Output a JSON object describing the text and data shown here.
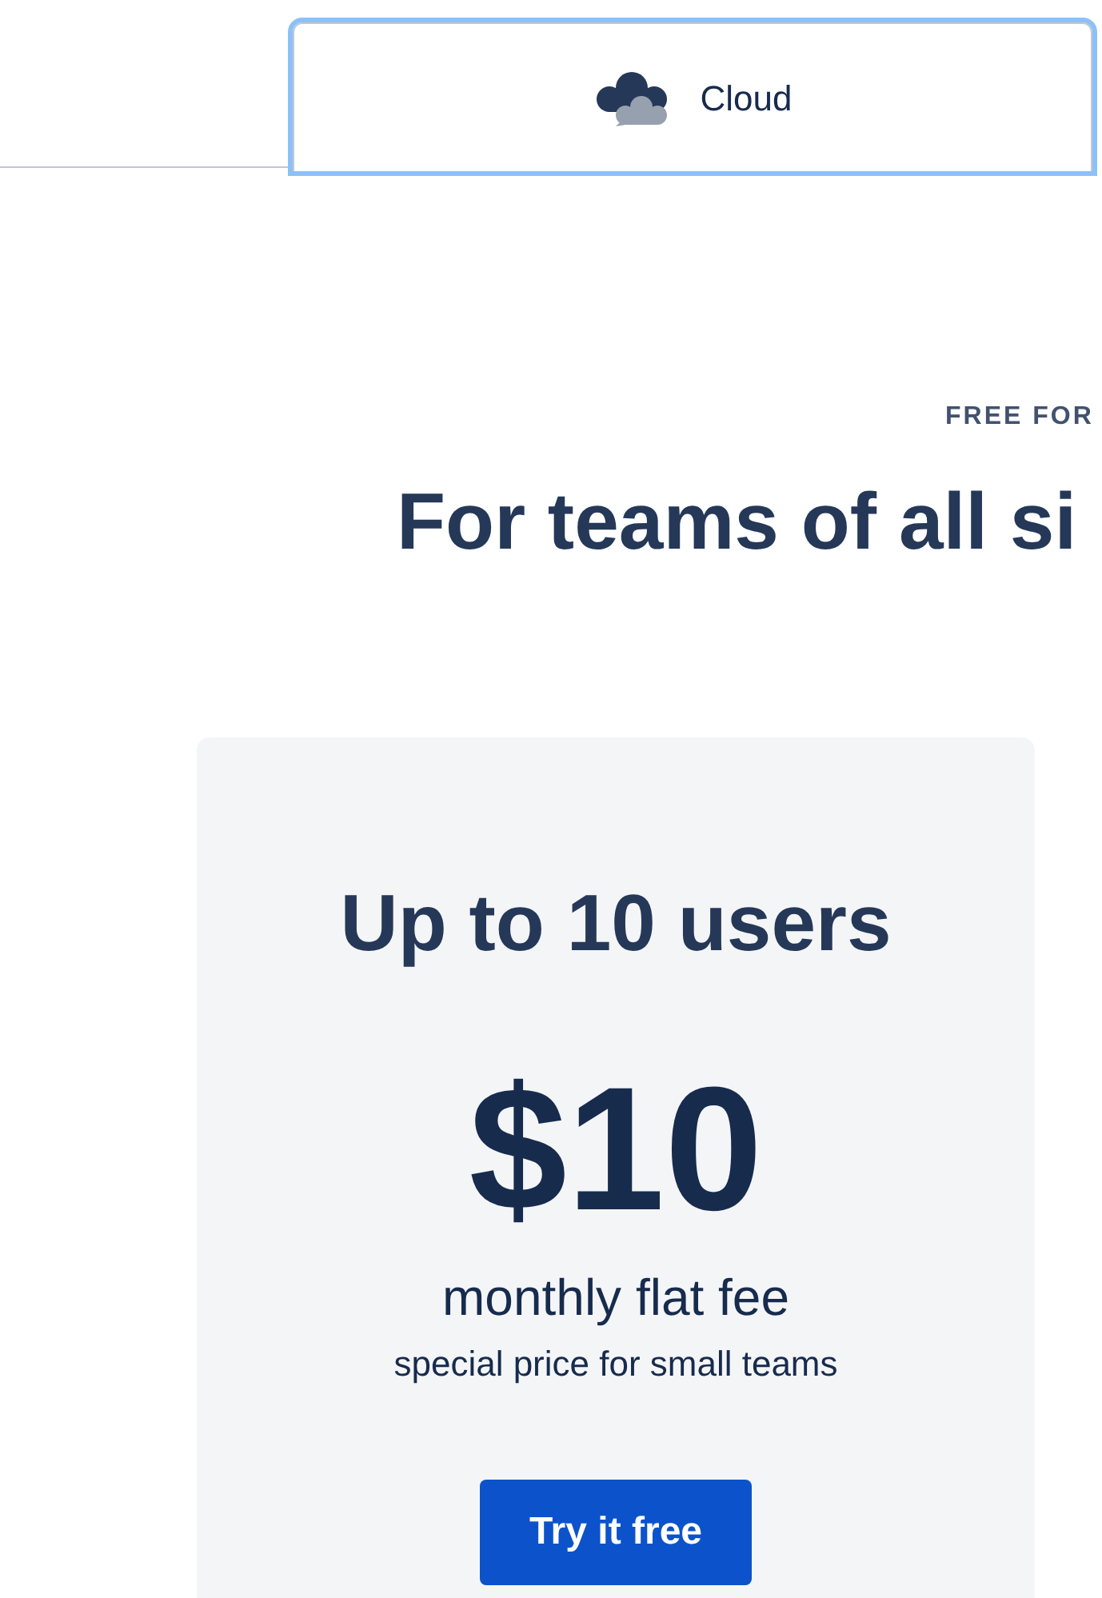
{
  "tabs": [
    {
      "label": "Cloud",
      "selected": true,
      "focused": true
    }
  ],
  "hero": {
    "eyebrow": "FREE FOR",
    "title": "For teams of all si"
  },
  "plan": {
    "title": "Up to 10 users",
    "price": "$10",
    "period": "monthly flat fee",
    "note": "special price for small teams",
    "button": "Try it free"
  }
}
